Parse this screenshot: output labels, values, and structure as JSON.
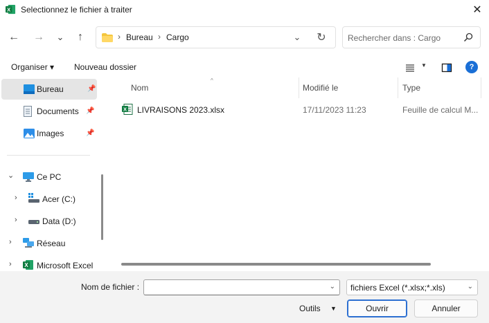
{
  "window": {
    "title": "Selectionnez le fichier à traiter",
    "close_glyph": "✕"
  },
  "nav": {
    "back_glyph": "←",
    "forward_glyph": "→",
    "recent_glyph": "⌄",
    "up_glyph": "↑"
  },
  "address": {
    "sep1": "›",
    "crumb1": "Bureau",
    "sep2": "›",
    "crumb2": "Cargo",
    "dropdown_glyph": "⌄",
    "refresh_glyph": "↻"
  },
  "search": {
    "placeholder": "Rechercher dans : Cargo"
  },
  "toolbar": {
    "organize": "Organiser ▾",
    "new_folder": "Nouveau dossier",
    "view_caret": "▼",
    "help": "?"
  },
  "sidebar": {
    "pin_glyph": "📌",
    "items": [
      {
        "label": "Bureau",
        "pinned": true,
        "selected": true
      },
      {
        "label": "Documents",
        "pinned": true
      },
      {
        "label": "Images",
        "pinned": true
      },
      {
        "label": "Ce PC",
        "chevron": "⌄"
      },
      {
        "label": "Acer (C:)",
        "chevron": "›"
      },
      {
        "label": "Data (D:)",
        "chevron": "›"
      },
      {
        "label": "Réseau",
        "chevron": "›"
      },
      {
        "label": "Microsoft Excel",
        "chevron": "›"
      }
    ]
  },
  "columns": {
    "name": "Nom",
    "modified": "Modifié le",
    "type": "Type",
    "sort_glyph": "^"
  },
  "files": [
    {
      "name": "LIVRAISONS 2023.xlsx",
      "modified": "17/11/2023 11:23",
      "type": "Feuille de calcul M..."
    }
  ],
  "footer": {
    "filename_label": "Nom de fichier :",
    "filename_value": "",
    "dropdown_glyph": "⌄",
    "filter": "fichiers Excel (*.xlsx;*.xls)",
    "tools": "Outils",
    "tools_caret": "▼",
    "open": "Ouvrir",
    "cancel": "Annuler"
  },
  "colors": {
    "excel_green": "#1d7044",
    "folder_yellow": "#f4c63d",
    "accent_blue": "#1a6fd6"
  }
}
